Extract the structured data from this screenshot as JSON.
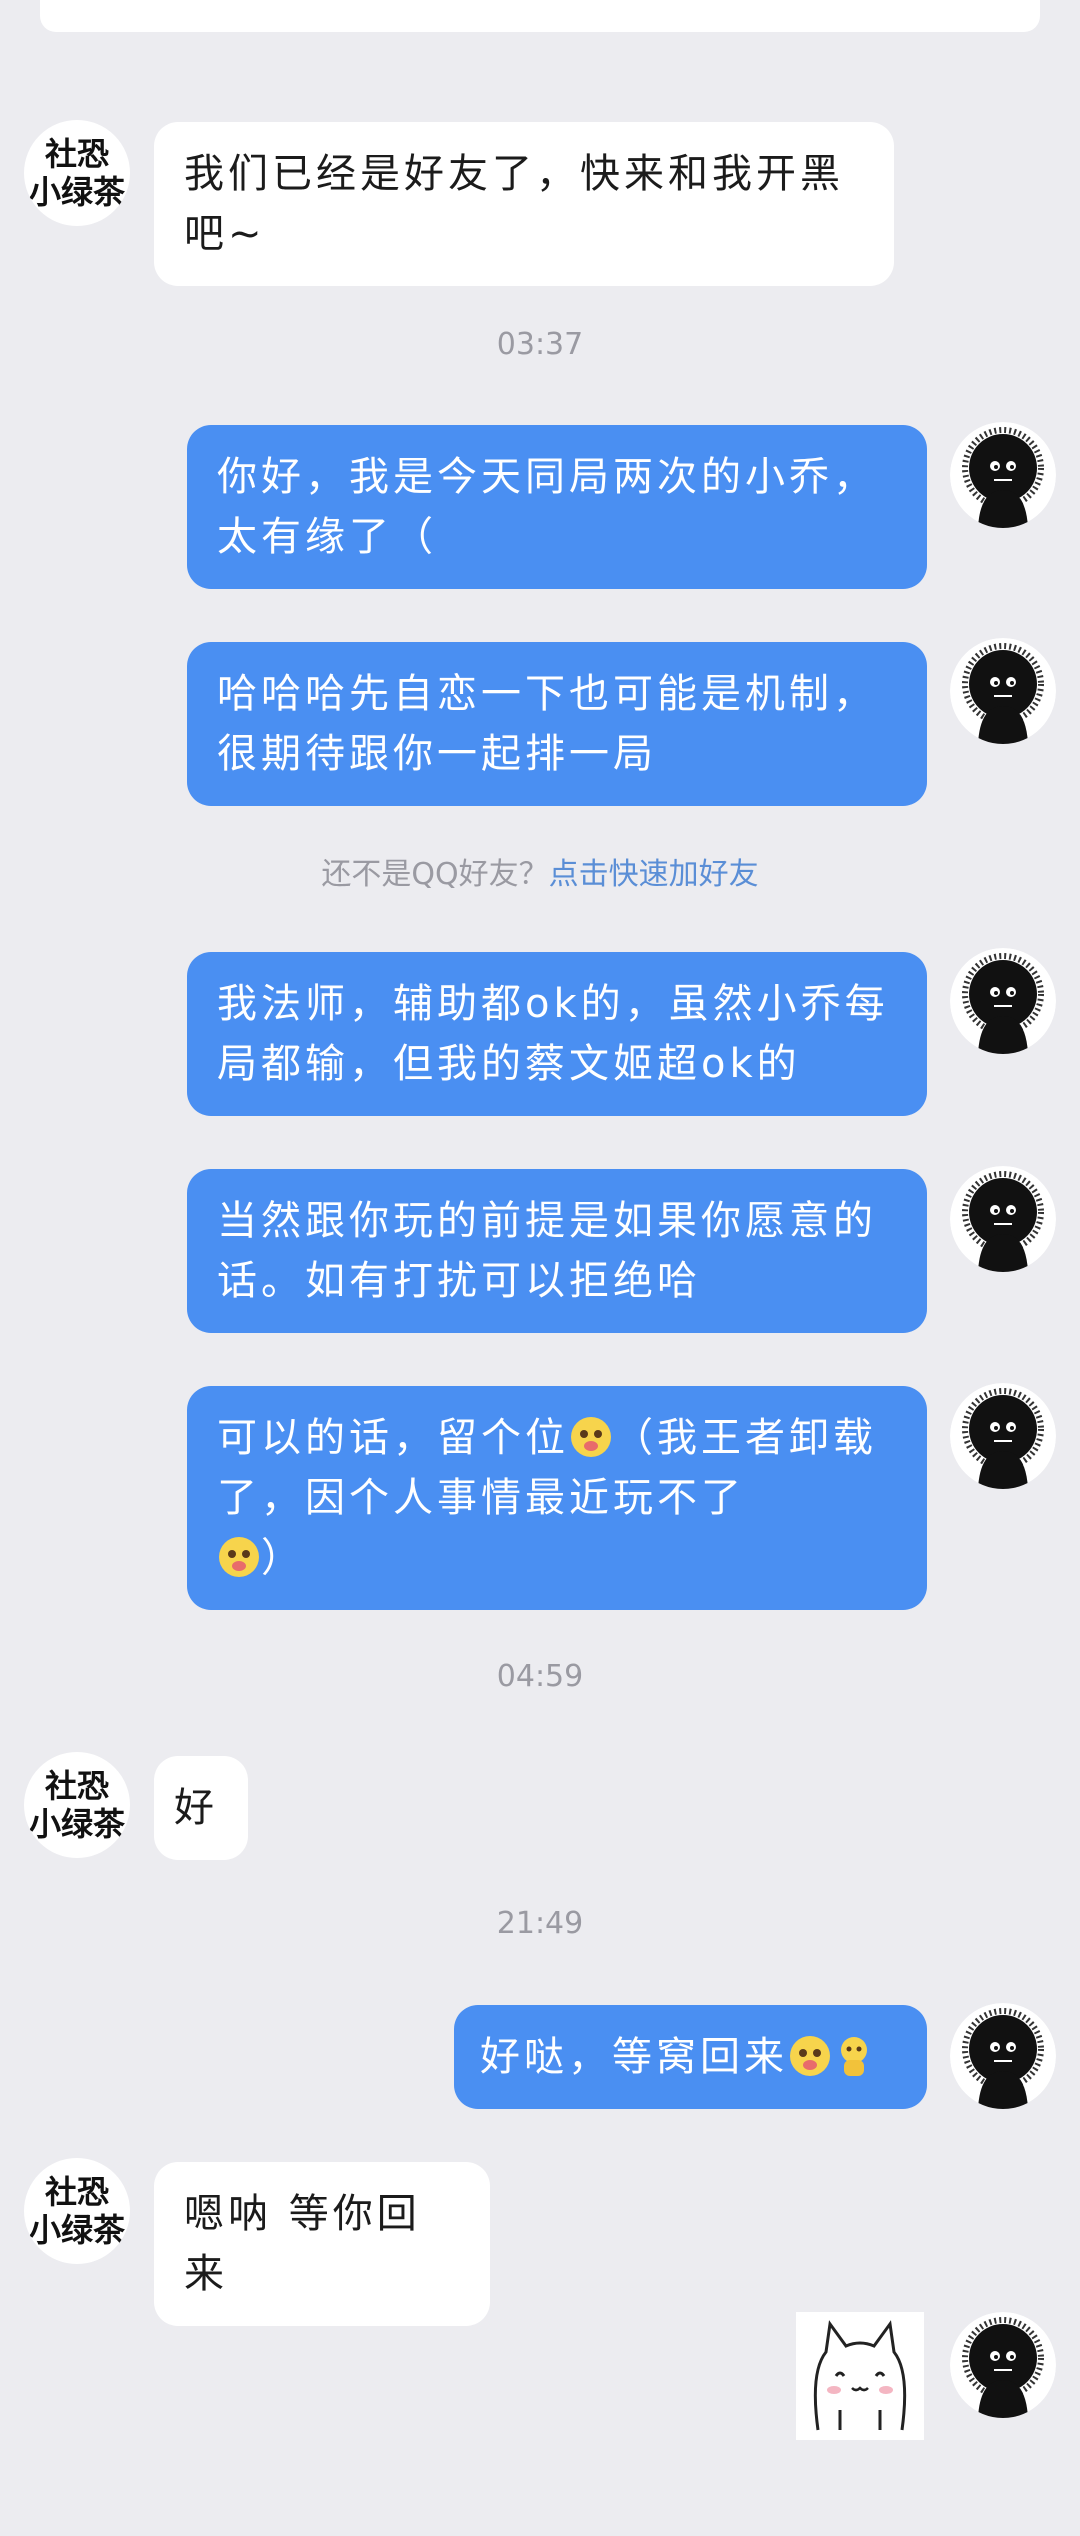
{
  "contact": {
    "avatar_line1": "社恐",
    "avatar_line2": "小绿茶"
  },
  "notice": {
    "text": "还不是QQ好友？",
    "link": "点击快速加好友"
  },
  "timestamps": [
    "03:37",
    "04:59",
    "21:49"
  ],
  "messages": [
    {
      "side": "in",
      "text": "我们已经是好友了，快来和我开黑吧~"
    },
    {
      "side": "out",
      "text": "你好，我是今天同局两次的小乔，太有缘了（"
    },
    {
      "side": "out",
      "text": "哈哈哈先自恋一下也可能是机制，很期待跟你一起排一局"
    },
    {
      "side": "out",
      "text": "我法师，辅助都ok的，虽然小乔每局都输，但我的蔡文姬超ok的"
    },
    {
      "side": "out",
      "text": "当然跟你玩的前提是如果你愿意的话。如有打扰可以拒绝哈"
    },
    {
      "side": "out",
      "text_a": "可以的话，留个位",
      "text_b": "（我王者卸载了，因个人事情最近玩不了",
      "text_c": "）"
    },
    {
      "side": "in",
      "text": "好"
    },
    {
      "side": "out",
      "text": "好哒，等窝回来"
    },
    {
      "side": "in",
      "text": "嗯呐 等你回来"
    },
    {
      "side": "out",
      "type": "sticker",
      "sticker": "white-cat-sticker"
    }
  ],
  "colors": {
    "background": "#ececf0",
    "outgoing_bubble": "#4a8ff2",
    "incoming_bubble": "#ffffff",
    "timestamp": "#9a9aa2",
    "link": "#5a8ed6"
  }
}
